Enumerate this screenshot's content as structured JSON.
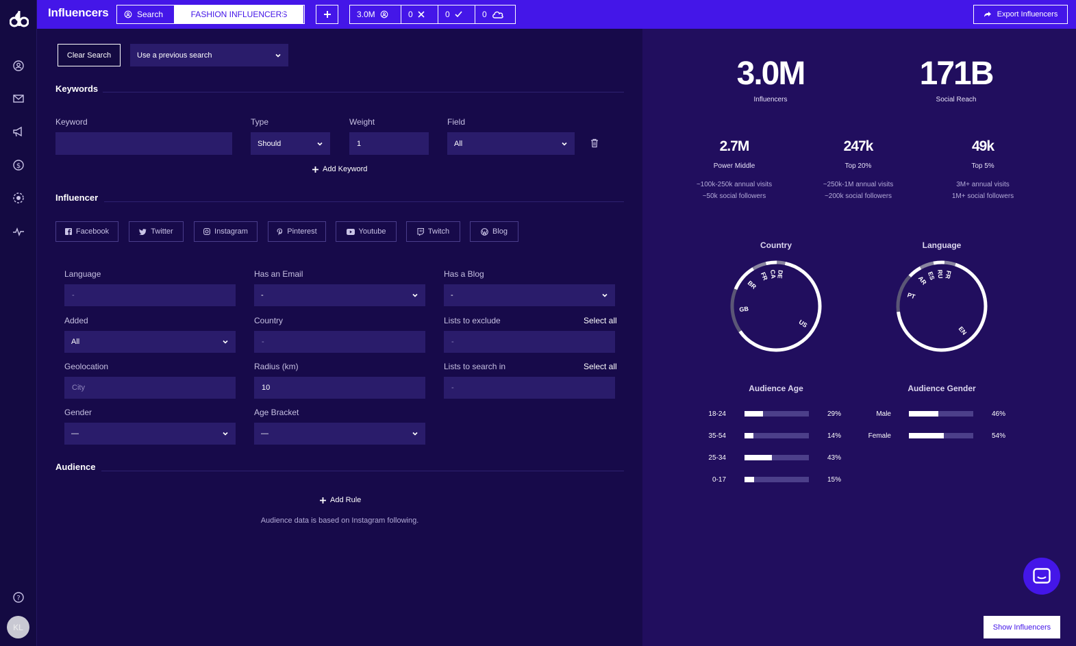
{
  "app": {
    "title": "Influencers",
    "avatar_initials": "KL"
  },
  "breadcrumb": {
    "search_label": "Search",
    "current": "FASHION INFLUENCERS"
  },
  "stats_bar": {
    "influencers": "3.0M",
    "rejected": "0",
    "accepted": "0",
    "saved": "0"
  },
  "header": {
    "export_label": "Export Influencers"
  },
  "search": {
    "clear_label": "Clear Search",
    "previous_label": "Use a previous search"
  },
  "keywords": {
    "section_title": "Keywords",
    "keyword_label": "Keyword",
    "keyword_value": "",
    "type_label": "Type",
    "type_value": "Should",
    "weight_label": "Weight",
    "weight_value": "1",
    "field_label": "Field",
    "field_value": "All",
    "add_label": "Add Keyword"
  },
  "influencer": {
    "section_title": "Influencer",
    "networks": [
      "Facebook",
      "Twitter",
      "Instagram",
      "Pinterest",
      "Youtube",
      "Twitch",
      "Blog"
    ],
    "language_label": "Language",
    "language_value": "-",
    "has_email_label": "Has an Email",
    "has_email_value": "-",
    "has_blog_label": "Has a Blog",
    "has_blog_value": "-",
    "added_label": "Added",
    "added_value": "All",
    "country_label": "Country",
    "country_value": "-",
    "lists_exclude_label": "Lists to exclude",
    "lists_exclude_value": "-",
    "geolocation_label": "Geolocation",
    "geolocation_placeholder": "City",
    "radius_label": "Radius (km)",
    "radius_value": "10",
    "lists_search_label": "Lists to search in",
    "lists_search_value": "-",
    "select_all_label": "Select all",
    "gender_label": "Gender",
    "gender_value": "—",
    "age_label": "Age Bracket",
    "age_value": "—"
  },
  "audience": {
    "section_title": "Audience",
    "add_rule_label": "Add Rule",
    "note": "Audience data is based on Instagram following."
  },
  "summary": {
    "influencers": {
      "value": "3.0M",
      "label": "Influencers"
    },
    "reach": {
      "value": "171B",
      "label": "Social Reach"
    },
    "tiers": [
      {
        "value": "2.7M",
        "label": "Power Middle",
        "desc1": "~100k-250k annual visits",
        "desc2": "~50k social followers"
      },
      {
        "value": "247k",
        "label": "Top 20%",
        "desc1": "~250k-1M annual visits",
        "desc2": "~200k social followers"
      },
      {
        "value": "49k",
        "label": "Top 5%",
        "desc1": "3M+ annual visits",
        "desc2": "1M+ social followers"
      }
    ]
  },
  "chart_data": [
    {
      "type": "pie",
      "title": "Country",
      "categories": [
        "US",
        "GB",
        "BR",
        "FR",
        "CA",
        "DE"
      ],
      "values": [
        62,
        16,
        10,
        5,
        4,
        3
      ],
      "colors": [
        "#ffffff",
        "#5b5676",
        "#ffffff",
        "#8a86a0",
        "#ffffff",
        "#8a86a0"
      ]
    },
    {
      "type": "pie",
      "title": "Language",
      "categories": [
        "EN",
        "PT",
        "AR",
        "ES",
        "RU",
        "FR"
      ],
      "values": [
        68,
        14,
        5,
        5,
        4,
        4
      ],
      "colors": [
        "#ffffff",
        "#5b5676",
        "#ffffff",
        "#8a86a0",
        "#ffffff",
        "#8a86a0"
      ]
    },
    {
      "type": "bar",
      "title": "Audience Age",
      "categories": [
        "18-24",
        "35-54",
        "25-34",
        "0-17"
      ],
      "values": [
        29,
        14,
        43,
        15
      ],
      "labels": [
        "29%",
        "14%",
        "43%",
        "15%"
      ]
    },
    {
      "type": "bar",
      "title": "Audience Gender",
      "categories": [
        "Male",
        "Female"
      ],
      "values": [
        46,
        54
      ],
      "labels": [
        "46%",
        "54%"
      ]
    }
  ],
  "colors": {
    "accent": "#4416e8",
    "background": "#170a4a",
    "panel": "#210e5e"
  }
}
